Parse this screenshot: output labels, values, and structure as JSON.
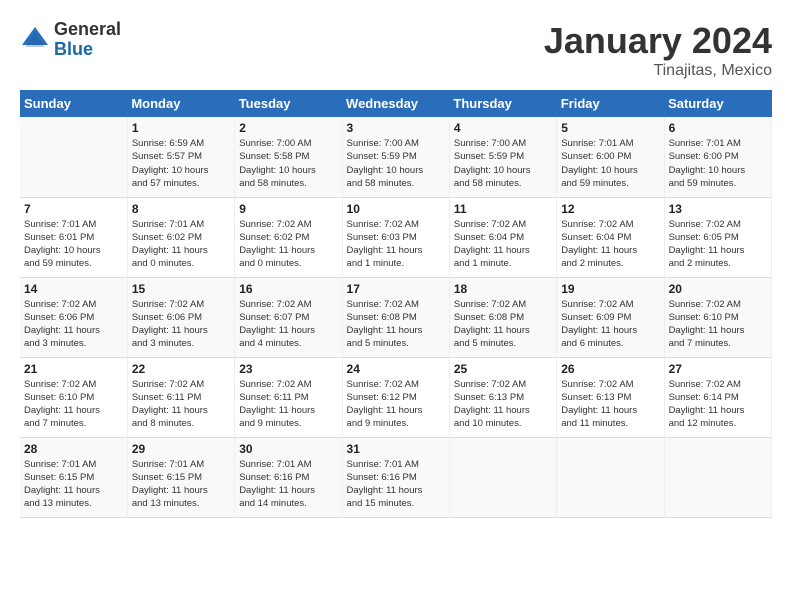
{
  "header": {
    "logo": {
      "general": "General",
      "blue": "Blue"
    },
    "title": "January 2024",
    "location": "Tinajitas, Mexico"
  },
  "days_of_week": [
    "Sunday",
    "Monday",
    "Tuesday",
    "Wednesday",
    "Thursday",
    "Friday",
    "Saturday"
  ],
  "weeks": [
    [
      {
        "day": "",
        "info": ""
      },
      {
        "day": "1",
        "info": "Sunrise: 6:59 AM\nSunset: 5:57 PM\nDaylight: 10 hours\nand 57 minutes."
      },
      {
        "day": "2",
        "info": "Sunrise: 7:00 AM\nSunset: 5:58 PM\nDaylight: 10 hours\nand 58 minutes."
      },
      {
        "day": "3",
        "info": "Sunrise: 7:00 AM\nSunset: 5:59 PM\nDaylight: 10 hours\nand 58 minutes."
      },
      {
        "day": "4",
        "info": "Sunrise: 7:00 AM\nSunset: 5:59 PM\nDaylight: 10 hours\nand 58 minutes."
      },
      {
        "day": "5",
        "info": "Sunrise: 7:01 AM\nSunset: 6:00 PM\nDaylight: 10 hours\nand 59 minutes."
      },
      {
        "day": "6",
        "info": "Sunrise: 7:01 AM\nSunset: 6:00 PM\nDaylight: 10 hours\nand 59 minutes."
      }
    ],
    [
      {
        "day": "7",
        "info": "Sunrise: 7:01 AM\nSunset: 6:01 PM\nDaylight: 10 hours\nand 59 minutes."
      },
      {
        "day": "8",
        "info": "Sunrise: 7:01 AM\nSunset: 6:02 PM\nDaylight: 11 hours\nand 0 minutes."
      },
      {
        "day": "9",
        "info": "Sunrise: 7:02 AM\nSunset: 6:02 PM\nDaylight: 11 hours\nand 0 minutes."
      },
      {
        "day": "10",
        "info": "Sunrise: 7:02 AM\nSunset: 6:03 PM\nDaylight: 11 hours\nand 1 minute."
      },
      {
        "day": "11",
        "info": "Sunrise: 7:02 AM\nSunset: 6:04 PM\nDaylight: 11 hours\nand 1 minute."
      },
      {
        "day": "12",
        "info": "Sunrise: 7:02 AM\nSunset: 6:04 PM\nDaylight: 11 hours\nand 2 minutes."
      },
      {
        "day": "13",
        "info": "Sunrise: 7:02 AM\nSunset: 6:05 PM\nDaylight: 11 hours\nand 2 minutes."
      }
    ],
    [
      {
        "day": "14",
        "info": "Sunrise: 7:02 AM\nSunset: 6:06 PM\nDaylight: 11 hours\nand 3 minutes."
      },
      {
        "day": "15",
        "info": "Sunrise: 7:02 AM\nSunset: 6:06 PM\nDaylight: 11 hours\nand 3 minutes."
      },
      {
        "day": "16",
        "info": "Sunrise: 7:02 AM\nSunset: 6:07 PM\nDaylight: 11 hours\nand 4 minutes."
      },
      {
        "day": "17",
        "info": "Sunrise: 7:02 AM\nSunset: 6:08 PM\nDaylight: 11 hours\nand 5 minutes."
      },
      {
        "day": "18",
        "info": "Sunrise: 7:02 AM\nSunset: 6:08 PM\nDaylight: 11 hours\nand 5 minutes."
      },
      {
        "day": "19",
        "info": "Sunrise: 7:02 AM\nSunset: 6:09 PM\nDaylight: 11 hours\nand 6 minutes."
      },
      {
        "day": "20",
        "info": "Sunrise: 7:02 AM\nSunset: 6:10 PM\nDaylight: 11 hours\nand 7 minutes."
      }
    ],
    [
      {
        "day": "21",
        "info": "Sunrise: 7:02 AM\nSunset: 6:10 PM\nDaylight: 11 hours\nand 7 minutes."
      },
      {
        "day": "22",
        "info": "Sunrise: 7:02 AM\nSunset: 6:11 PM\nDaylight: 11 hours\nand 8 minutes."
      },
      {
        "day": "23",
        "info": "Sunrise: 7:02 AM\nSunset: 6:11 PM\nDaylight: 11 hours\nand 9 minutes."
      },
      {
        "day": "24",
        "info": "Sunrise: 7:02 AM\nSunset: 6:12 PM\nDaylight: 11 hours\nand 9 minutes."
      },
      {
        "day": "25",
        "info": "Sunrise: 7:02 AM\nSunset: 6:13 PM\nDaylight: 11 hours\nand 10 minutes."
      },
      {
        "day": "26",
        "info": "Sunrise: 7:02 AM\nSunset: 6:13 PM\nDaylight: 11 hours\nand 11 minutes."
      },
      {
        "day": "27",
        "info": "Sunrise: 7:02 AM\nSunset: 6:14 PM\nDaylight: 11 hours\nand 12 minutes."
      }
    ],
    [
      {
        "day": "28",
        "info": "Sunrise: 7:01 AM\nSunset: 6:15 PM\nDaylight: 11 hours\nand 13 minutes."
      },
      {
        "day": "29",
        "info": "Sunrise: 7:01 AM\nSunset: 6:15 PM\nDaylight: 11 hours\nand 13 minutes."
      },
      {
        "day": "30",
        "info": "Sunrise: 7:01 AM\nSunset: 6:16 PM\nDaylight: 11 hours\nand 14 minutes."
      },
      {
        "day": "31",
        "info": "Sunrise: 7:01 AM\nSunset: 6:16 PM\nDaylight: 11 hours\nand 15 minutes."
      },
      {
        "day": "",
        "info": ""
      },
      {
        "day": "",
        "info": ""
      },
      {
        "day": "",
        "info": ""
      }
    ]
  ]
}
